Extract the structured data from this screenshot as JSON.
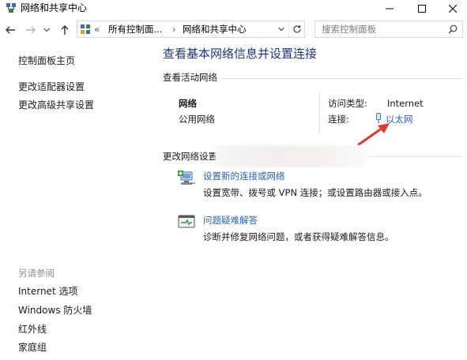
{
  "window": {
    "title": "网络和共享中心"
  },
  "nav": {
    "breadcrumb_overflow": "«",
    "breadcrumb": [
      "所有控制面...",
      "网络和共享中心"
    ],
    "search_placeholder": "搜索控制面板"
  },
  "sidebar": {
    "links": [
      "控制面板主页",
      "更改适配器设置",
      "更改高级共享设置"
    ],
    "see_also_heading": "另请参阅",
    "see_also": [
      "Internet 选项",
      "Windows 防火墙",
      "红外线",
      "家庭组"
    ]
  },
  "main": {
    "title": "查看基本网络信息并设置连接",
    "active_networks_label": "查看活动网络",
    "network": {
      "name": "网络",
      "type": "公用网络",
      "access_type_label": "访问类型:",
      "access_type_value": "Internet",
      "connections_label": "连接:",
      "connection_link": "以太网"
    },
    "change_settings_label": "更改网络设置",
    "tasks": [
      {
        "title": "设置新的连接或网络",
        "desc": "设置宽带、拨号或 VPN 连接；或设置路由器或接入点。"
      },
      {
        "title": "问题疑难解答",
        "desc": "诊断并修复网络问题，或者获得疑难解答信息。"
      }
    ]
  },
  "colors": {
    "title_blue": "#1e3287",
    "link_blue": "#2a62b8",
    "arrow_red": "#e03a2f",
    "muted_gray": "#8c8c8c"
  },
  "icons": [
    "network-center-icon",
    "minimize-icon",
    "maximize-icon",
    "close-icon",
    "back-arrow-icon",
    "forward-arrow-icon",
    "up-arrow-icon",
    "control-panel-icon",
    "dropdown-chevron-icon",
    "refresh-icon",
    "search-icon",
    "ethernet-icon",
    "setup-connection-icon",
    "troubleshoot-icon",
    "red-arrow-annotation"
  ]
}
